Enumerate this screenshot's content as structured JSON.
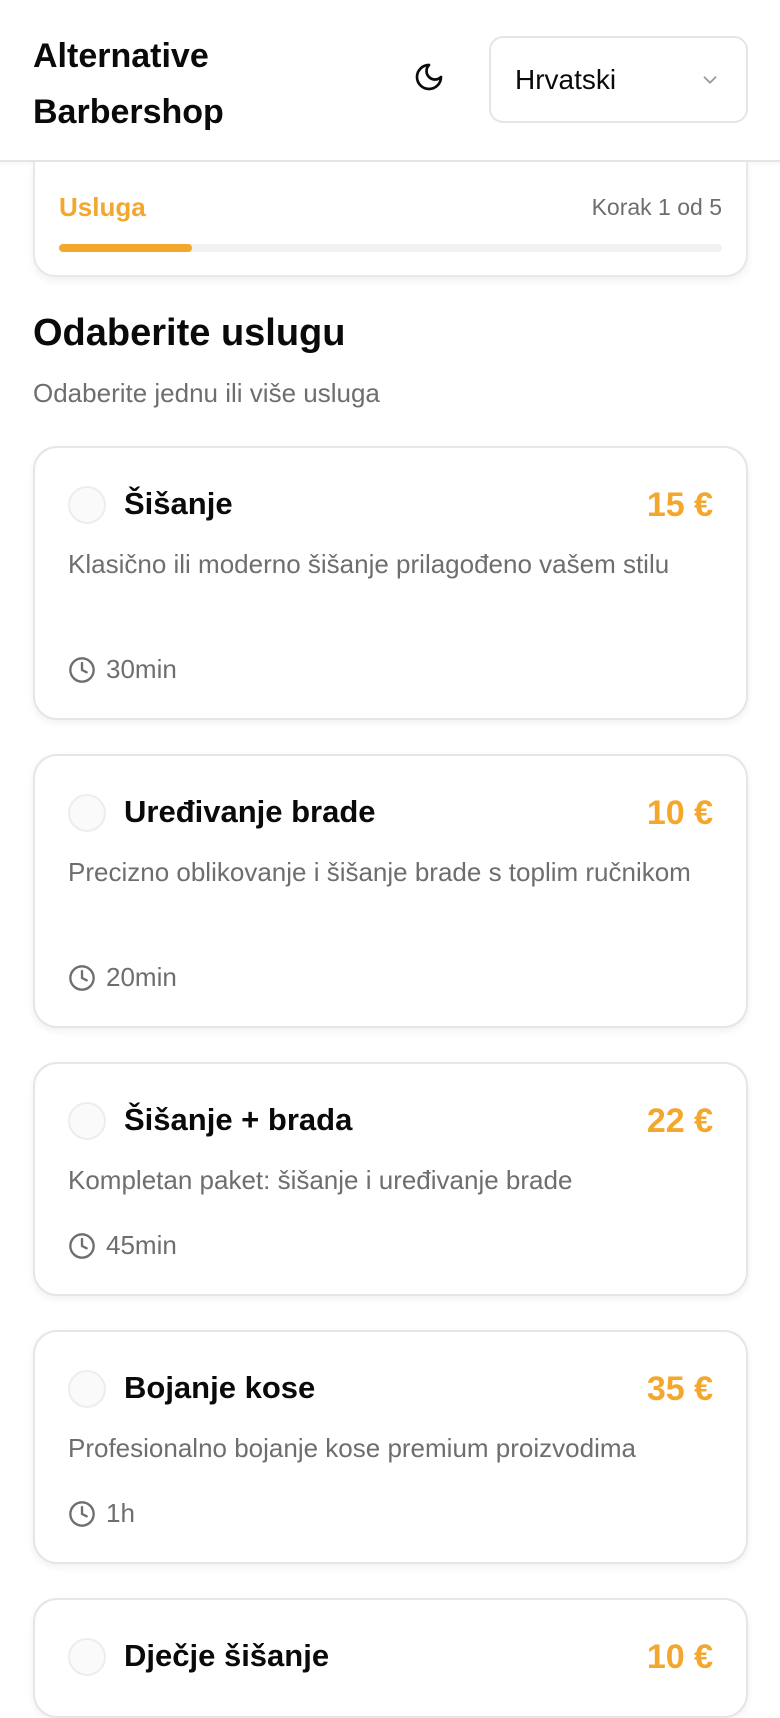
{
  "header": {
    "brand": "Alternative Barbershop",
    "theme_icon": "moon-icon",
    "language": "Hrvatski",
    "language_icon": "chevron-down-icon"
  },
  "stepper": {
    "step_name": "Usluga",
    "step_count": "Korak 1 od 5",
    "progress_fraction": 0.2
  },
  "section": {
    "title": "Odaberite uslugu",
    "subtitle": "Odaberite jednu ili više usluga"
  },
  "services": [
    {
      "name": "Šišanje",
      "price": "15 €",
      "description": "Klasično ili moderno šišanje prilagođeno vašem stilu",
      "duration": "30min",
      "selected": false
    },
    {
      "name": "Uređivanje brade",
      "price": "10 €",
      "description": "Precizno oblikovanje i šišanje brade s toplim ručnikom",
      "duration": "20min",
      "selected": false
    },
    {
      "name": "Šišanje + brada",
      "price": "22 €",
      "description": "Kompletan paket: šišanje i uređivanje brade",
      "duration": "45min",
      "selected": false
    },
    {
      "name": "Bojanje kose",
      "price": "35 €",
      "description": "Profesionalno bojanje kose premium proizvodima",
      "duration": "1h",
      "selected": false
    },
    {
      "name": "Dječje šišanje",
      "price": "10 €",
      "selected": false
    }
  ],
  "colors": {
    "accent": "#f3a72c",
    "muted_text": "#6e6e6e",
    "border": "#e6e6e6"
  }
}
